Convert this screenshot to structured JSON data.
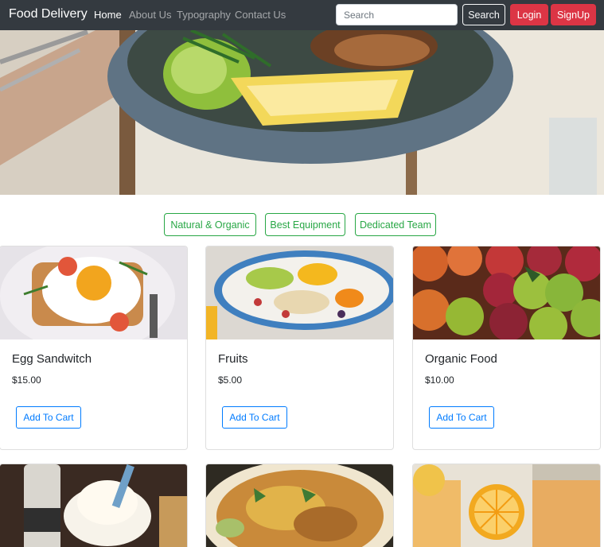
{
  "navbar": {
    "brand": "Food Delivery",
    "links": [
      "Home",
      "About Us",
      "Typography",
      "Contact Us"
    ],
    "active_link": "Home",
    "search_placeholder": "Search",
    "search_button": "Search",
    "login_button": "Login",
    "signup_button": "SignUp",
    "colors": {
      "background": "#343a40",
      "danger": "#dc3545"
    }
  },
  "hero": {
    "image": "plated-food-bowl-photo"
  },
  "features": {
    "items": [
      "Natural & Organic",
      "Best Equipment",
      "Dedicated Team"
    ],
    "color": "#28a745"
  },
  "products": [
    {
      "name": "Egg Sandwitch",
      "price": "$15.00",
      "button": "Add To Cart",
      "image": "egg-sandwich-photo"
    },
    {
      "name": "Fruits",
      "price": "$5.00",
      "button": "Add To Cart",
      "image": "fruit-platter-photo"
    },
    {
      "name": "Organic Food",
      "price": "$10.00",
      "button": "Add To Cart",
      "image": "apples-photo"
    },
    {
      "name": "",
      "price": "",
      "button": "",
      "image": "dessert-photo"
    },
    {
      "name": "",
      "price": "",
      "button": "",
      "image": "biryani-photo"
    },
    {
      "name": "",
      "price": "",
      "button": "",
      "image": "orange-drink-photo"
    }
  ],
  "accent_colors": {
    "primary": "#007bff"
  }
}
